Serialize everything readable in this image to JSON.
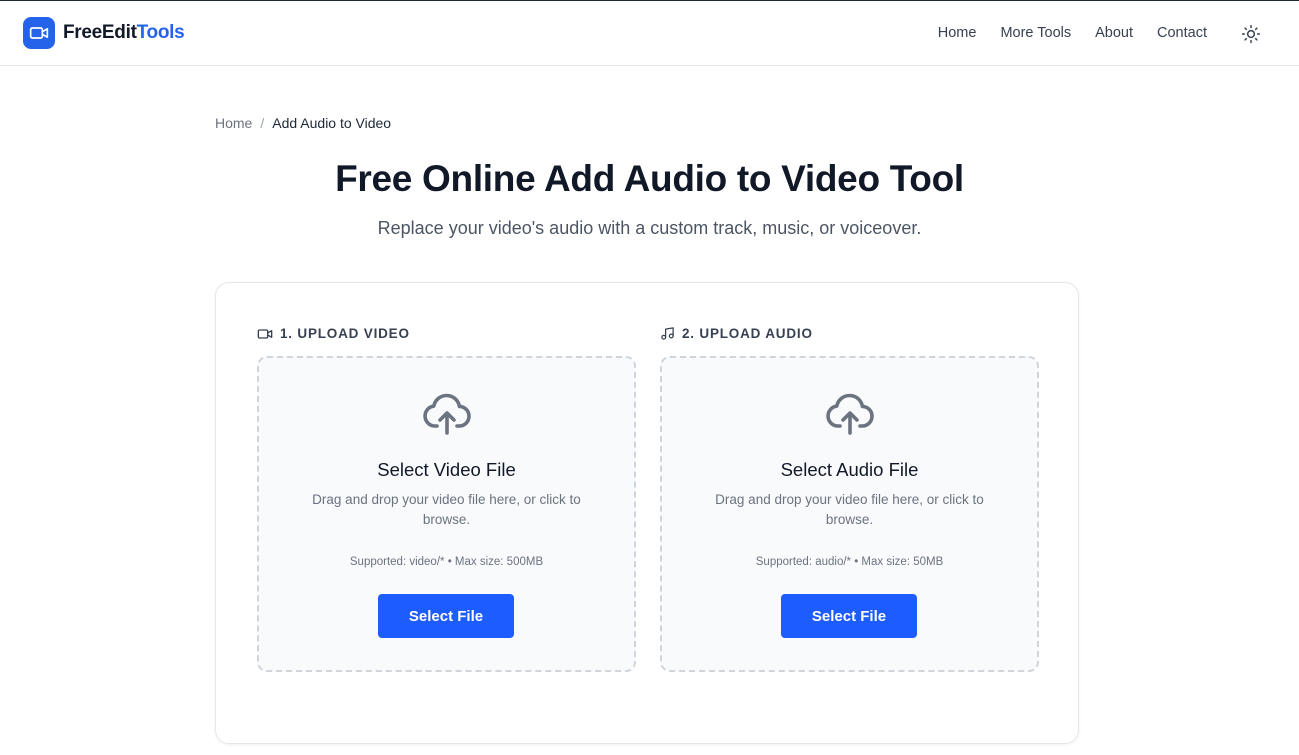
{
  "header": {
    "brand_part1": "FreeEdit",
    "brand_part2": "Tools",
    "nav": [
      "Home",
      "More Tools",
      "About",
      "Contact"
    ]
  },
  "breadcrumb": {
    "home": "Home",
    "separator": "/",
    "current": "Add Audio to Video"
  },
  "page": {
    "title": "Free Online Add Audio to Video Tool",
    "subtitle": "Replace your video's audio with a custom track, music, or voiceover."
  },
  "uploads": [
    {
      "label": "1. UPLOAD VIDEO",
      "title": "Select Video File",
      "description": "Drag and drop your video file here, or click to browse.",
      "supported": "Supported: video/* • Max size: 500MB",
      "button": "Select File"
    },
    {
      "label": "2. UPLOAD AUDIO",
      "title": "Select Audio File",
      "description": "Drag and drop your video file here, or click to browse.",
      "supported": "Supported: audio/* • Max size: 50MB",
      "button": "Select File"
    }
  ],
  "icons": {
    "logo": "video-camera-icon",
    "theme_toggle": "sun-icon",
    "video_section": "video-icon",
    "audio_section": "music-note-icon",
    "upload": "cloud-upload-icon"
  },
  "colors": {
    "accent": "#2563eb",
    "button": "#1d5cff",
    "text_dark": "#111827",
    "text_muted": "#6b7280",
    "dropzone_bg": "#f9fafb",
    "dropzone_border": "#d1d5db"
  }
}
